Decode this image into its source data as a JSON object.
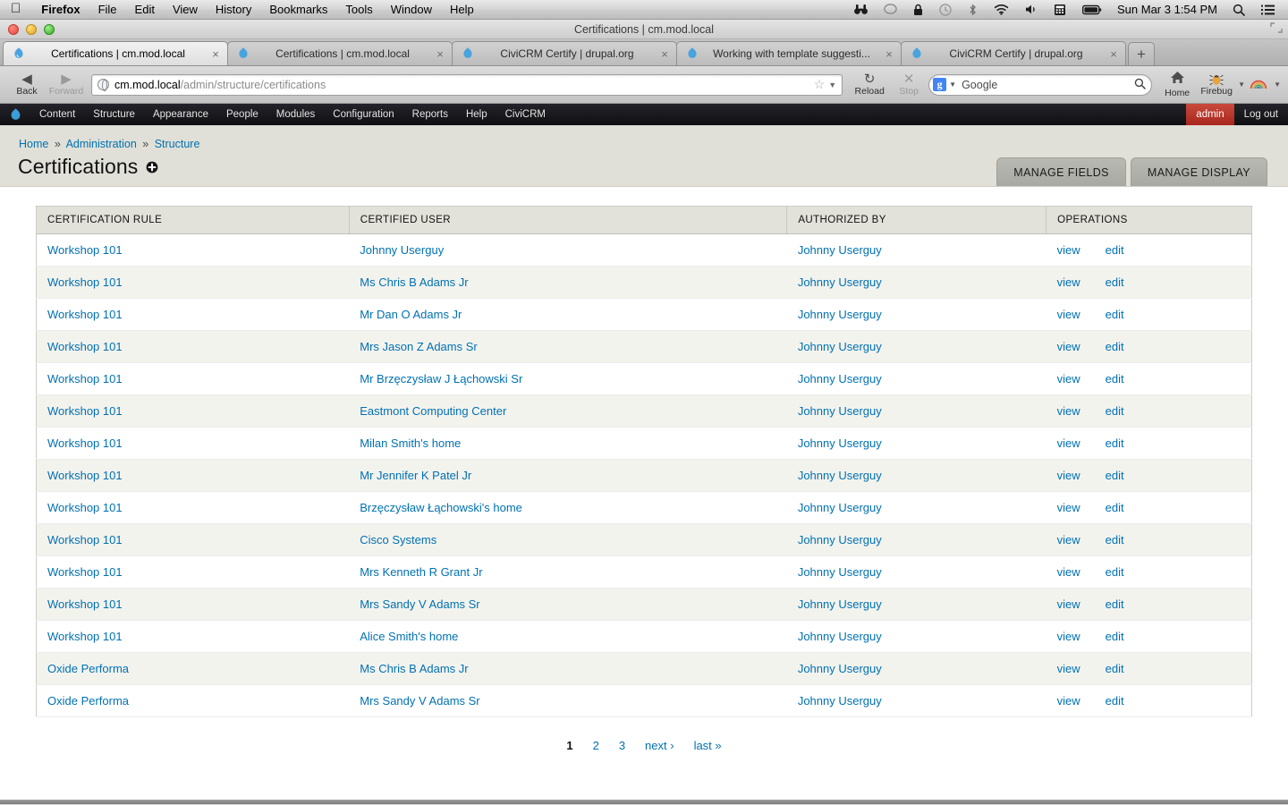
{
  "os_menubar": {
    "apple_icon": "apple-icon",
    "items": [
      {
        "label": "Firefox",
        "bold": true
      },
      {
        "label": "File",
        "bold": false
      },
      {
        "label": "Edit",
        "bold": false
      },
      {
        "label": "View",
        "bold": false
      },
      {
        "label": "History",
        "bold": false
      },
      {
        "label": "Bookmarks",
        "bold": false
      },
      {
        "label": "Tools",
        "bold": false
      },
      {
        "label": "Window",
        "bold": false
      },
      {
        "label": "Help",
        "bold": false
      }
    ],
    "status_icons": [
      {
        "name": "binoculars-icon",
        "glyph": "⌗"
      },
      {
        "name": "chat-bubble-icon",
        "glyph": "◯"
      },
      {
        "name": "lock-icon",
        "glyph": "ὑ2"
      },
      {
        "name": "time-machine-icon",
        "glyph": "↺"
      },
      {
        "name": "bluetooth-icon",
        "glyph": "✦"
      },
      {
        "name": "wifi-icon",
        "glyph": "◠"
      },
      {
        "name": "volume-icon",
        "glyph": "◂"
      },
      {
        "name": "calculator-icon",
        "glyph": "⌸"
      },
      {
        "name": "battery-icon",
        "glyph": "▭"
      }
    ],
    "clock": "Sun Mar 3  1:54 PM",
    "spotlight_icon": "search-icon",
    "notification_icon": "list-icon"
  },
  "browser": {
    "window_title": "Certifications | cm.mod.local",
    "tabs": [
      {
        "label": "Certifications | cm.mod.local",
        "active": true
      },
      {
        "label": "Certifications | cm.mod.local",
        "active": false
      },
      {
        "label": "CiviCRM Certify | drupal.org",
        "active": false
      },
      {
        "label": "Working with template suggesti...",
        "active": false
      },
      {
        "label": "CiviCRM Certify | drupal.org",
        "active": false
      }
    ],
    "new_tab_label": "+",
    "close_tab_label": "×",
    "nav": {
      "back_label": "Back",
      "forward_label": "Forward",
      "reload_label": "Reload",
      "stop_label": "Stop",
      "home_label": "Home",
      "firebug_label": "Firebug"
    },
    "url": {
      "host": "cm.mod.local",
      "path": "/admin/structure/certifications"
    },
    "search": {
      "engine_badge": "g",
      "placeholder": "Google"
    }
  },
  "drupal_toolbar": {
    "logo_icon": "drupal-drop-icon",
    "items": [
      "Content",
      "Structure",
      "Appearance",
      "People",
      "Modules",
      "Configuration",
      "Reports",
      "Help",
      "CiviCRM"
    ],
    "user": "admin",
    "logout": "Log out",
    "user_bg": "#b8332a"
  },
  "page": {
    "breadcrumb": [
      "Home",
      "Administration",
      "Structure"
    ],
    "breadcrumb_sep": "»",
    "title": "Certifications",
    "title_gear_icon": "gear-icon",
    "action_tabs": [
      "MANAGE FIELDS",
      "MANAGE DISPLAY"
    ],
    "link_color": "#0071b3"
  },
  "table": {
    "headers": [
      "CERTIFICATION RULE",
      "CERTIFIED USER",
      "AUTHORIZED BY",
      "OPERATIONS"
    ],
    "op_view": "view",
    "op_edit": "edit",
    "rows": [
      {
        "rule": "Workshop 101",
        "user": "Johnny Userguy",
        "auth": "Johnny Userguy"
      },
      {
        "rule": "Workshop 101",
        "user": "Ms Chris B Adams Jr",
        "auth": "Johnny Userguy"
      },
      {
        "rule": "Workshop 101",
        "user": "Mr Dan O Adams Jr",
        "auth": "Johnny Userguy"
      },
      {
        "rule": "Workshop 101",
        "user": "Mrs Jason Z Adams Sr",
        "auth": "Johnny Userguy"
      },
      {
        "rule": "Workshop 101",
        "user": "Mr Brzęczysław J Łąchowski Sr",
        "auth": "Johnny Userguy"
      },
      {
        "rule": "Workshop 101",
        "user": "Eastmont Computing Center",
        "auth": "Johnny Userguy"
      },
      {
        "rule": "Workshop 101",
        "user": "Milan Smith's home",
        "auth": "Johnny Userguy"
      },
      {
        "rule": "Workshop 101",
        "user": "Mr Jennifer K Patel Jr",
        "auth": "Johnny Userguy"
      },
      {
        "rule": "Workshop 101",
        "user": "Brzęczysław Łąchowski's home",
        "auth": "Johnny Userguy"
      },
      {
        "rule": "Workshop 101",
        "user": "Cisco Systems",
        "auth": "Johnny Userguy"
      },
      {
        "rule": "Workshop 101",
        "user": "Mrs Kenneth R Grant Jr",
        "auth": "Johnny Userguy"
      },
      {
        "rule": "Workshop 101",
        "user": "Mrs Sandy V Adams Sr",
        "auth": "Johnny Userguy"
      },
      {
        "rule": "Workshop 101",
        "user": "Alice Smith's home",
        "auth": "Johnny Userguy"
      },
      {
        "rule": "Oxide Performa",
        "user": "Ms Chris B Adams Jr",
        "auth": "Johnny Userguy"
      },
      {
        "rule": "Oxide Performa",
        "user": "Mrs Sandy V Adams Sr",
        "auth": "Johnny Userguy"
      }
    ]
  },
  "pager": {
    "pages": [
      "1",
      "2",
      "3"
    ],
    "current": "1",
    "next": "next ›",
    "last": "last »"
  }
}
